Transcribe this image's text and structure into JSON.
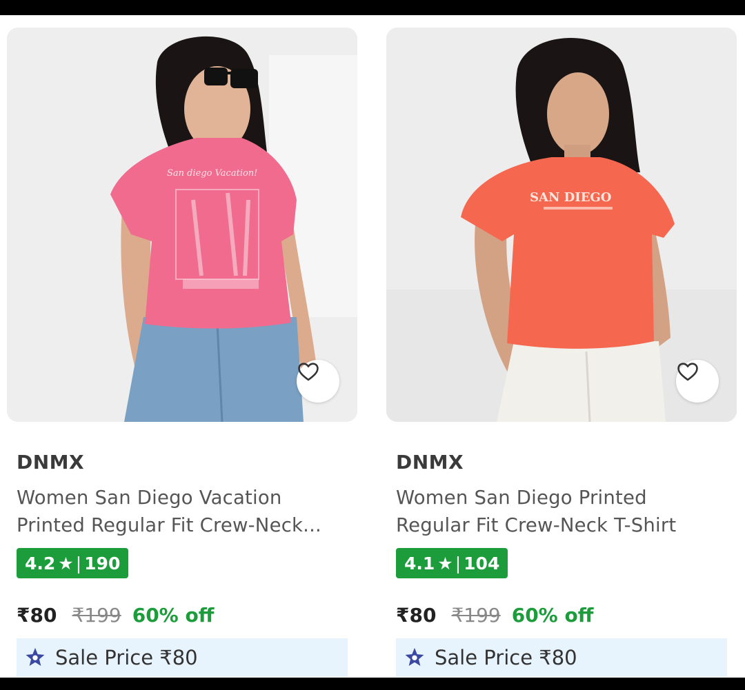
{
  "products": [
    {
      "brand": "DNMX",
      "title_line1": "Women San Diego Vacation",
      "title_line2": "Printed Regular Fit Crew-Neck...",
      "rating": "4.2",
      "rating_count": "190",
      "price": "₹80",
      "mrp": "₹199",
      "discount": "60% off",
      "sale_label": "Sale Price ₹80",
      "shirt_print_text": "San diego Vacation!",
      "colors": {
        "shirt": "#f06b8e",
        "bottoms": "#7aa1c4"
      }
    },
    {
      "brand": "DNMX",
      "title_line1": "Women San Diego Printed",
      "title_line2": "Regular Fit Crew-Neck T-Shirt",
      "rating": "4.1",
      "rating_count": "104",
      "price": "₹80",
      "mrp": "₹199",
      "discount": "60% off",
      "sale_label": "Sale Price ₹80",
      "shirt_print_text": "SAN DIEGO",
      "colors": {
        "shirt": "#f5684f",
        "bottoms": "#f1f0ea"
      }
    }
  ],
  "icons": {
    "wishlist": "heart-outline-icon",
    "rating": "star-icon",
    "sale": "star-badge-icon"
  },
  "colors": {
    "rating_bg": "#1c9c3b",
    "discount": "#1c9c3b",
    "sale_bg": "#e7f4fd",
    "sale_icon": "#3b4aa0"
  }
}
